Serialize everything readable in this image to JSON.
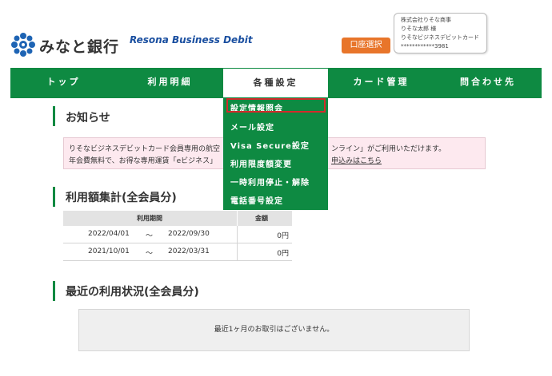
{
  "header": {
    "bank_name": "みなと銀行",
    "product_name": "Resona Business Debit",
    "account_select_label": "口座選択",
    "user": {
      "company": "株式会社りそな商事",
      "name": "りそな太郎 様",
      "card_name": "りそなビジネスデビットカード",
      "card_number": "************3981"
    }
  },
  "nav": {
    "items": [
      "トップ",
      "利用明細",
      "各種設定",
      "カード管理",
      "問合わせ先"
    ],
    "active": "各種設定"
  },
  "dropdown": {
    "items": [
      "設定情報照会",
      "メール設定",
      "Visa Secure設定",
      "利用限度額変更",
      "一時利用停止・解除",
      "電話番号設定"
    ],
    "highlighted": "設定情報照会"
  },
  "notice": {
    "title": "お知らせ",
    "line1_start": "りそなビジネスデビットカード会員専用の航空",
    "line1_end": "ンライン」がご利用いただけます。",
    "line2_start": "年会費無料で、お得な専用運賃「eビジネス」",
    "line2_link": "申込みはこちら"
  },
  "usage_total": {
    "title": "利用額集計(全会員分)",
    "headers": [
      "利用期間",
      "金額"
    ],
    "rows": [
      {
        "from": "2022/04/01",
        "sep": "～",
        "to": "2022/09/30",
        "amount": "0円"
      },
      {
        "from": "2021/10/01",
        "sep": "～",
        "to": "2022/03/31",
        "amount": "0円"
      }
    ]
  },
  "recent": {
    "title": "最近の利用状況(全会員分)",
    "empty_message": "最近1ヶ月のお取引はございません。"
  },
  "colors": {
    "brand_green": "#0e8a42",
    "accent_orange": "#e8752a",
    "highlight_red": "#d22b2b",
    "notice_pink": "#fde9ef"
  }
}
